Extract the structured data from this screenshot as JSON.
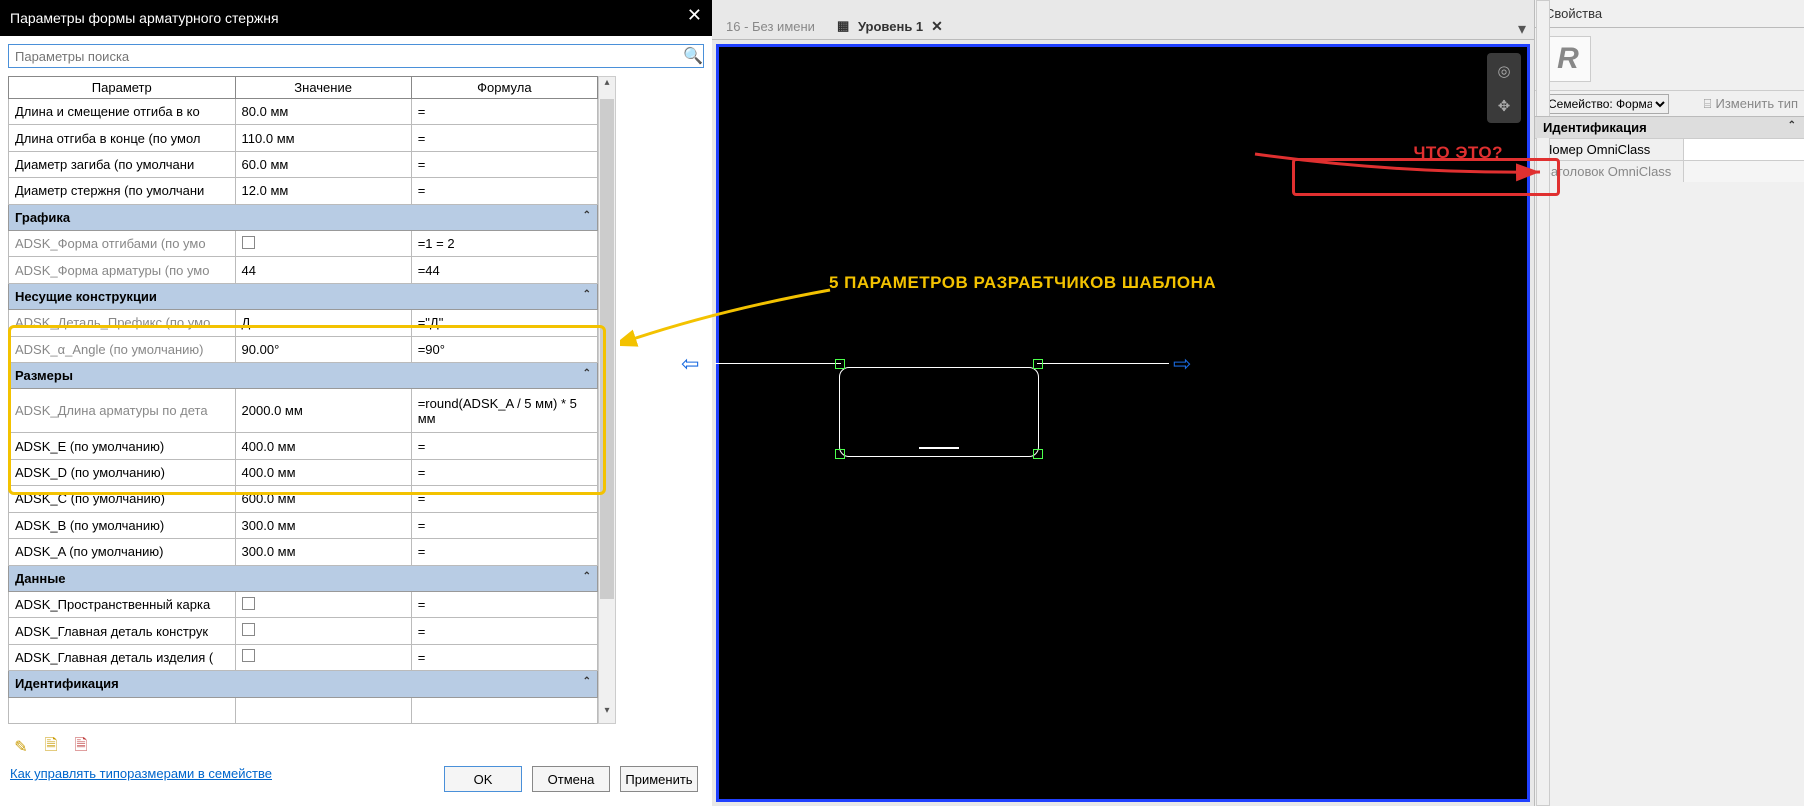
{
  "dialog": {
    "title": "Параметры формы арматурного стержня",
    "search_placeholder": "Параметры поиска",
    "headers": {
      "param": "Параметр",
      "value": "Значение",
      "formula": "Формула"
    },
    "basic_rows": [
      {
        "name": "Длина и смещение отгиба в ко",
        "value": "80.0 мм",
        "formula": "="
      },
      {
        "name": "Длина отгиба в конце (по умол",
        "value": "110.0 мм",
        "formula": "="
      },
      {
        "name": "Диаметр загиба (по умолчани",
        "value": "60.0 мм",
        "formula": "="
      },
      {
        "name": "Диаметр стержня (по умолчани",
        "value": "12.0 мм",
        "formula": "="
      }
    ],
    "group_graphics": "Графика",
    "graphics_rows": [
      {
        "name": "ADSK_Форма отгибами (по умо",
        "value_checkbox": true,
        "formula": "=1 = 2"
      },
      {
        "name": "ADSK_Форма арматуры (по умо",
        "value": "44",
        "formula": "=44"
      }
    ],
    "group_struct": "Несущие конструкции",
    "struct_rows": [
      {
        "name": "ADSK_Деталь_Префикс (по умо",
        "value": "Д",
        "formula": "=\"Д\""
      },
      {
        "name": "ADSK_α_Angle (по умолчанию)",
        "value": "90.00°",
        "formula": "=90°"
      }
    ],
    "group_dims": "Размеры",
    "dims_rows": [
      {
        "name": "ADSK_Длина арматуры по дета",
        "value": "2000.0 мм",
        "formula": "=round(ADSK_A / 5 мм) * 5 мм",
        "gray": true
      },
      {
        "name": "ADSK_E (по умолчанию)",
        "value": "400.0 мм",
        "formula": "="
      },
      {
        "name": "ADSK_D (по умолчанию)",
        "value": "400.0 мм",
        "formula": "="
      },
      {
        "name": "ADSK_C (по умолчанию)",
        "value": "600.0 мм",
        "formula": "="
      },
      {
        "name": "ADSK_B (по умолчанию)",
        "value": "300.0 мм",
        "formula": "="
      },
      {
        "name": "ADSK_A (по умолчанию)",
        "value": "300.0 мм",
        "formula": "="
      }
    ],
    "group_data": "Данные",
    "data_rows": [
      {
        "name": "ADSK_Пространственный карка",
        "value_checkbox": true,
        "formula": "="
      },
      {
        "name": "ADSK_Главная деталь конструк",
        "value_checkbox": true,
        "formula": "="
      },
      {
        "name": "ADSK_Главная деталь изделия (",
        "value_checkbox": true,
        "formula": "="
      }
    ],
    "group_ident": "Идентификация",
    "help_link": "Как управлять типоразмерами в семействе",
    "buttons": {
      "ok": "OK",
      "cancel": "Отмена",
      "apply": "Применить"
    }
  },
  "tabs": {
    "inactive": "16 - Без имени",
    "active": "Уровень 1"
  },
  "annotation": {
    "red": "ЧТО ЭТО?",
    "yellow": "5 ПАРАМЕТРОВ РАЗРАБТЧИКОВ ШАБЛОНА"
  },
  "properties": {
    "title": "Свойства",
    "family_label": "Семейство: Форма ар",
    "edit_type": "Изменить тип",
    "group_ident": "Идентификация",
    "rows": [
      {
        "k": "Номер OmniClass",
        "v": ""
      },
      {
        "k": "Заголовок OmniClass",
        "v": ""
      }
    ]
  }
}
